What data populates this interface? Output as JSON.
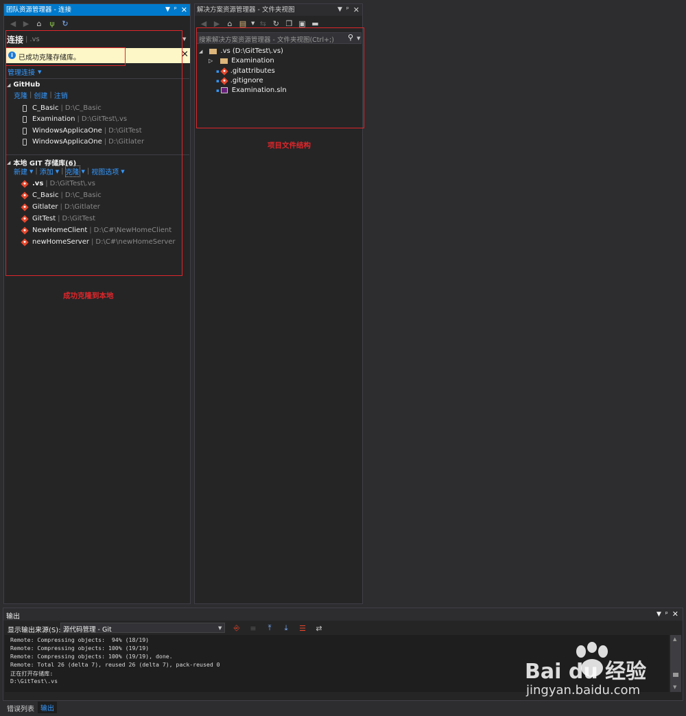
{
  "team_explorer": {
    "title": "团队资源管理器 - 连接",
    "connect_heading": "连接",
    "connect_repo": ".vs",
    "notification": "已成功克隆存储库。",
    "manage_connections": "管理连接",
    "github": {
      "heading": "GitHub",
      "links": [
        "克隆",
        "创建",
        "注销"
      ],
      "repos": [
        {
          "name": "C_Basic",
          "path": "D:\\C_Basic"
        },
        {
          "name": "Examination",
          "path": "D:\\GitTest\\.vs"
        },
        {
          "name": "WindowsApplicaOne",
          "path": "D:\\GitTest"
        },
        {
          "name": "WindowsApplicaOne",
          "path": "D:\\Gitlater"
        }
      ]
    },
    "local": {
      "heading": "本地 GIT 存储库(6)",
      "actions": [
        "新建",
        "添加",
        "克隆",
        "视图选项"
      ],
      "repos": [
        {
          "name": ".vs",
          "path": "D:\\GitTest\\.vs"
        },
        {
          "name": "C_Basic",
          "path": "D:\\C_Basic"
        },
        {
          "name": "Gitlater",
          "path": "D:\\Gitlater"
        },
        {
          "name": "GitTest",
          "path": "D:\\GitTest"
        },
        {
          "name": "NewHomeClient",
          "path": "D:\\C#\\NewHomeClient"
        },
        {
          "name": "newHomeServer",
          "path": "D:\\C#\\newHomeServer"
        }
      ]
    },
    "annotation": "成功克隆到本地"
  },
  "solution_explorer": {
    "title": "解决方案资源管理器 - 文件夹视图",
    "search_placeholder": "搜索解决方案资源管理器 - 文件夹视图(Ctrl+;)",
    "tree": {
      "root": ".vs (D:\\GitTest\\.vs)",
      "items": [
        "Examination",
        ".gitattributes",
        ".gitignore",
        "Examination.sln"
      ]
    },
    "annotation": "项目文件结构"
  },
  "output": {
    "title": "输出",
    "source_label": "显示输出来源(S):",
    "source_value": "源代码管理 - Git",
    "lines": [
      "Remote: Compressing objects:  94% (18/19)",
      "Remote: Compressing objects: 100% (19/19)",
      "Remote: Compressing objects: 100% (19/19), done.",
      "Remote: Total 26 (delta 7), reused 26 (delta 7), pack-reused 0",
      "正在打开存储库:",
      "D:\\GitTest\\.vs"
    ]
  },
  "bottom_tabs": [
    "错误列表",
    "输出"
  ],
  "watermark": {
    "logo": "Bai du 经验",
    "url": "jingyan.baidu.com"
  },
  "colors": {
    "accent": "#007acc",
    "annotation": "#e0262a",
    "git": "#e8472c",
    "link": "#3399ff"
  }
}
